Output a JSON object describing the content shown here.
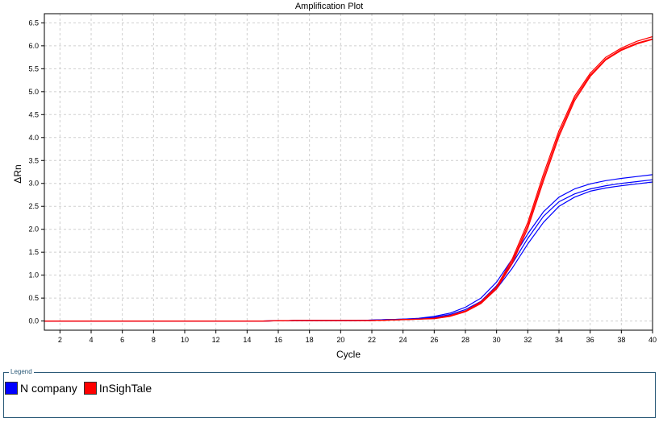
{
  "chart_data": {
    "type": "line",
    "title": "Amplification Plot",
    "xlabel": "Cycle",
    "ylabel": "ΔRn",
    "xlim": [
      1,
      40
    ],
    "ylim": [
      -0.2,
      6.7
    ],
    "x_ticks": [
      2,
      4,
      6,
      8,
      10,
      12,
      14,
      16,
      18,
      20,
      22,
      24,
      26,
      28,
      30,
      32,
      34,
      36,
      38,
      40
    ],
    "y_ticks": [
      0.0,
      0.5,
      1.0,
      1.5,
      2.0,
      2.5,
      3.0,
      3.5,
      4.0,
      4.5,
      5.0,
      5.5,
      6.0,
      6.5
    ],
    "y_tick_labels": [
      "0.0",
      "0.5",
      "1.0",
      "1.5",
      "2.0",
      "2.5",
      "3.0",
      "3.5",
      "4.0",
      "4.5",
      "5.0",
      "5.5",
      "6.0",
      "6.5"
    ],
    "grid": true,
    "legend_title": "Legend",
    "legend_position": "bottom",
    "x": [
      1,
      2,
      3,
      4,
      5,
      6,
      7,
      8,
      9,
      10,
      11,
      12,
      13,
      14,
      15,
      16,
      17,
      18,
      19,
      20,
      21,
      22,
      23,
      24,
      25,
      26,
      27,
      28,
      29,
      30,
      31,
      32,
      33,
      34,
      35,
      36,
      37,
      38,
      39,
      40
    ],
    "series": [
      {
        "name": "N company",
        "color": "#0000ff",
        "group": 0,
        "values": [
          0,
          0,
          0,
          0,
          0,
          0,
          0,
          0,
          0,
          0,
          0,
          0,
          0,
          0,
          0,
          0.005,
          0.01,
          0.01,
          0.01,
          0.01,
          0.01,
          0.02,
          0.03,
          0.04,
          0.06,
          0.1,
          0.17,
          0.3,
          0.5,
          0.85,
          1.35,
          1.9,
          2.38,
          2.7,
          2.88,
          2.99,
          3.06,
          3.11,
          3.15,
          3.19
        ]
      },
      {
        "name": "N company",
        "color": "#0000ff",
        "group": 0,
        "values": [
          0,
          0,
          0,
          0,
          0,
          0,
          0,
          0,
          0,
          0,
          0,
          0,
          0,
          0,
          0,
          0.005,
          0.01,
          0.01,
          0.01,
          0.01,
          0.01,
          0.02,
          0.03,
          0.04,
          0.05,
          0.08,
          0.14,
          0.25,
          0.43,
          0.77,
          1.25,
          1.8,
          2.28,
          2.6,
          2.77,
          2.88,
          2.95,
          3.0,
          3.04,
          3.08
        ]
      },
      {
        "name": "N company",
        "color": "#0000ff",
        "group": 0,
        "values": [
          0,
          0,
          0,
          0,
          0,
          0,
          0,
          0,
          0,
          0,
          0,
          0,
          0,
          0,
          0,
          0.005,
          0.01,
          0.01,
          0.01,
          0.01,
          0.01,
          0.02,
          0.03,
          0.04,
          0.05,
          0.07,
          0.12,
          0.22,
          0.39,
          0.7,
          1.15,
          1.68,
          2.15,
          2.5,
          2.7,
          2.83,
          2.9,
          2.95,
          2.99,
          3.03
        ]
      },
      {
        "name": "InSighTale",
        "color": "#ff0000",
        "group": 1,
        "values": [
          0,
          0,
          0,
          0,
          0,
          0,
          0,
          0,
          0,
          0,
          0,
          0,
          0,
          0,
          0,
          0.005,
          0.01,
          0.01,
          0.01,
          0.01,
          0.01,
          0.01,
          0.02,
          0.03,
          0.04,
          0.06,
          0.12,
          0.22,
          0.42,
          0.75,
          1.35,
          2.15,
          3.2,
          4.15,
          4.9,
          5.4,
          5.75,
          5.95,
          6.1,
          6.2
        ]
      },
      {
        "name": "InSighTale",
        "color": "#ff0000",
        "group": 1,
        "values": [
          0,
          0,
          0,
          0,
          0,
          0,
          0,
          0,
          0,
          0,
          0,
          0,
          0,
          0,
          0,
          0.005,
          0.01,
          0.01,
          0.01,
          0.01,
          0.01,
          0.01,
          0.02,
          0.03,
          0.04,
          0.06,
          0.11,
          0.21,
          0.4,
          0.73,
          1.3,
          2.08,
          3.12,
          4.08,
          4.85,
          5.36,
          5.71,
          5.92,
          6.06,
          6.15
        ]
      },
      {
        "name": "InSighTale",
        "color": "#ff0000",
        "group": 1,
        "values": [
          0,
          0,
          0,
          0,
          0,
          0,
          0,
          0,
          0,
          0,
          0,
          0,
          0,
          0,
          0,
          0.005,
          0.01,
          0.01,
          0.01,
          0.01,
          0.01,
          0.01,
          0.02,
          0.03,
          0.04,
          0.05,
          0.1,
          0.2,
          0.38,
          0.7,
          1.25,
          2.02,
          3.05,
          4.02,
          4.8,
          5.33,
          5.69,
          5.9,
          6.04,
          6.14
        ]
      }
    ],
    "legend": [
      {
        "label": "N company",
        "color": "#0000ff"
      },
      {
        "label": "InSighTale",
        "color": "#ff0000"
      }
    ]
  }
}
